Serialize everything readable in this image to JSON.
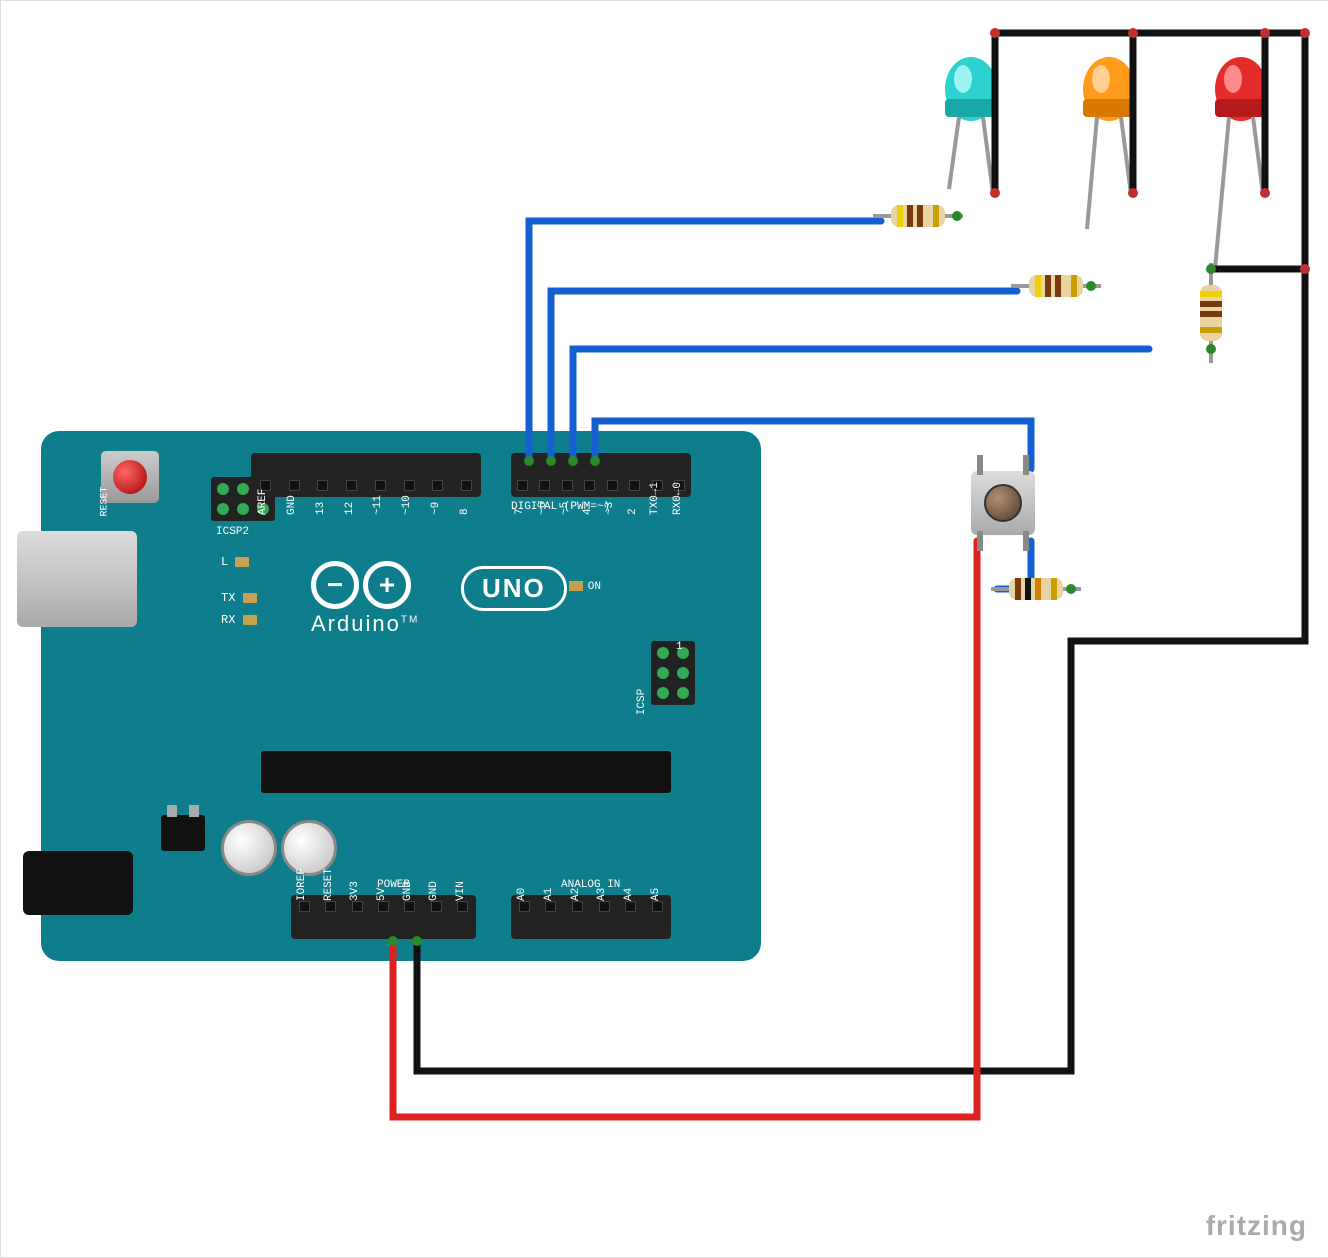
{
  "board": {
    "name": "Arduino",
    "model": "UNO",
    "trademark": "TM",
    "reset_label": "RESET",
    "icsp2_label": "ICSP2",
    "icsp_label": "ICSP",
    "digital_label": "DIGITAL (PWM=~)",
    "analog_label": "ANALOG IN",
    "power_label": "POWER",
    "on_label": "ON",
    "l_label": "L",
    "tx_label": "TX",
    "rx_label": "RX",
    "top_pins": [
      "AREF",
      "GND",
      "13",
      "12",
      "~11",
      "~10",
      "~9",
      "8",
      "7",
      "~6",
      "~5",
      "4",
      "~3",
      "2",
      "TX0→1",
      "RX0←0"
    ],
    "power_pins": [
      "IOREF",
      "RESET",
      "3V3",
      "5V",
      "GND",
      "GND",
      "VIN"
    ],
    "analog_pins": [
      "A0",
      "A1",
      "A2",
      "A3",
      "A4",
      "A5"
    ],
    "icsp_1": "1"
  },
  "components": {
    "led_cyan": {
      "color_body": "#2ed0d0",
      "color_light": "#9cf4f0"
    },
    "led_orange": {
      "color_body": "#ff9a1a",
      "color_light": "#ffd090"
    },
    "led_red": {
      "color_body": "#e52c2c",
      "color_light": "#ff8a8a"
    },
    "resistor_470": {
      "bands": [
        "#f0d000",
        "#7a3a10",
        "#7a3a10",
        "#caa000"
      ]
    },
    "resistor_10k": {
      "bands": [
        "#7a3a10",
        "#111",
        "#d08000",
        "#caa000"
      ]
    }
  },
  "wiring": {
    "d7_to": "LED cyan anode (via 470Ω)",
    "d6_to": "LED orange anode (via 470Ω)",
    "d5_to": "LED red anode (via 470Ω)",
    "d4_to": "Push button (with 10kΩ pulldown)",
    "5v_to": "Push button",
    "gnd_to": "LED cathodes & pulldown resistor"
  },
  "watermark": "fritzing"
}
